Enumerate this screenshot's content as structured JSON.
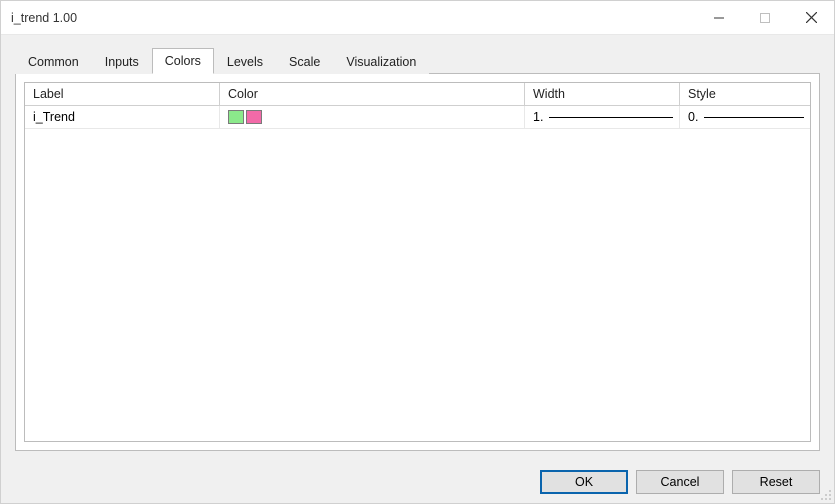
{
  "window": {
    "title": "i_trend 1.00"
  },
  "tabs": [
    {
      "label": "Common",
      "active": false
    },
    {
      "label": "Inputs",
      "active": false
    },
    {
      "label": "Colors",
      "active": true
    },
    {
      "label": "Levels",
      "active": false
    },
    {
      "label": "Scale",
      "active": false
    },
    {
      "label": "Visualization",
      "active": false
    }
  ],
  "columns": {
    "label": "Label",
    "color": "Color",
    "width": "Width",
    "style": "Style"
  },
  "rows": [
    {
      "label": "i_Trend",
      "colors": [
        "#8be98b",
        "#f26aa8"
      ],
      "width": "1.",
      "style": "0."
    }
  ],
  "buttons": {
    "ok": "OK",
    "cancel": "Cancel",
    "reset": "Reset"
  }
}
